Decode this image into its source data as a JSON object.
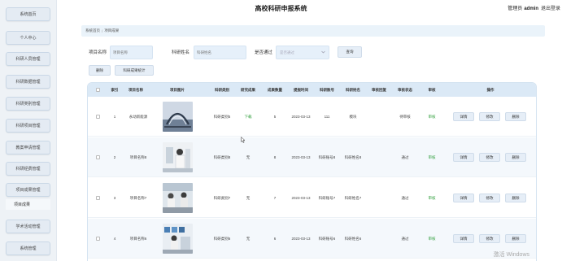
{
  "header": {
    "title": "高校科研申报系统",
    "user_role": "管理员",
    "user_name": "admin",
    "logout": "退出登录"
  },
  "sidebar": {
    "items": [
      {
        "label": "系统首页"
      },
      {
        "label": "个人中心"
      },
      {
        "label": "科研人员管理"
      },
      {
        "label": "科研数据管理"
      },
      {
        "label": "科研类别管理"
      },
      {
        "label": "科研项目管理"
      },
      {
        "label": "教案申请管理"
      },
      {
        "label": "科研经费管理"
      },
      {
        "label": "项目成果管理"
      },
      {
        "label": "学术活动管理"
      },
      {
        "label": "系统管理"
      }
    ],
    "active_sub": "项目成果"
  },
  "breadcrumb": {
    "home": "系统首页",
    "separator": "/",
    "current": "项目成果"
  },
  "search": {
    "name_label": "项目名称",
    "name_placeholder": "项目名称",
    "researcher_label": "科研姓名",
    "researcher_placeholder": "科研姓名",
    "pass_label": "是否通过",
    "pass_placeholder": "是否通过",
    "query_button": "查询"
  },
  "toolbar": {
    "delete_button": "删除",
    "stats_button": "科研成果统计"
  },
  "table": {
    "headers": [
      "索引",
      "项目名称",
      "项目图片",
      "科研类别",
      "研究成果",
      "成果数量",
      "提报时间",
      "科研账号",
      "科研姓名",
      "审核回复",
      "审核状态",
      "审核",
      "操作"
    ],
    "rows": [
      {
        "index": "1",
        "name": "永动新能源",
        "category": "科研类别5",
        "result": "下载",
        "count": "5",
        "date": "2023-03-13",
        "account": "111",
        "researcher": "模块",
        "reply": "",
        "status": "待审核",
        "review": "审核"
      },
      {
        "index": "2",
        "name": "项目名称8",
        "category": "科研类别8",
        "result": "无",
        "count": "8",
        "date": "2023-03-13",
        "account": "科研账号8",
        "researcher": "科研姓名8",
        "reply": "",
        "status": "通过",
        "review": "审核"
      },
      {
        "index": "3",
        "name": "项目名称7",
        "category": "科研类别7",
        "result": "无",
        "count": "7",
        "date": "2023-03-13",
        "account": "科研账号7",
        "researcher": "科研姓名7",
        "reply": "",
        "status": "通过",
        "review": "审核"
      },
      {
        "index": "4",
        "name": "项目名称6",
        "category": "科研类别6",
        "result": "无",
        "count": "6",
        "date": "2023-03-13",
        "account": "科研账号6",
        "researcher": "科研姓名6",
        "reply": "",
        "status": "通过",
        "review": "审核"
      }
    ],
    "actions": {
      "detail": "详情",
      "edit": "修改",
      "delete": "删除"
    }
  },
  "watermark": "激活 Windows",
  "colors": {
    "accent": "#dbe9f6",
    "review_green": "#2e9e3a",
    "result_link": "#2e9e3a"
  }
}
